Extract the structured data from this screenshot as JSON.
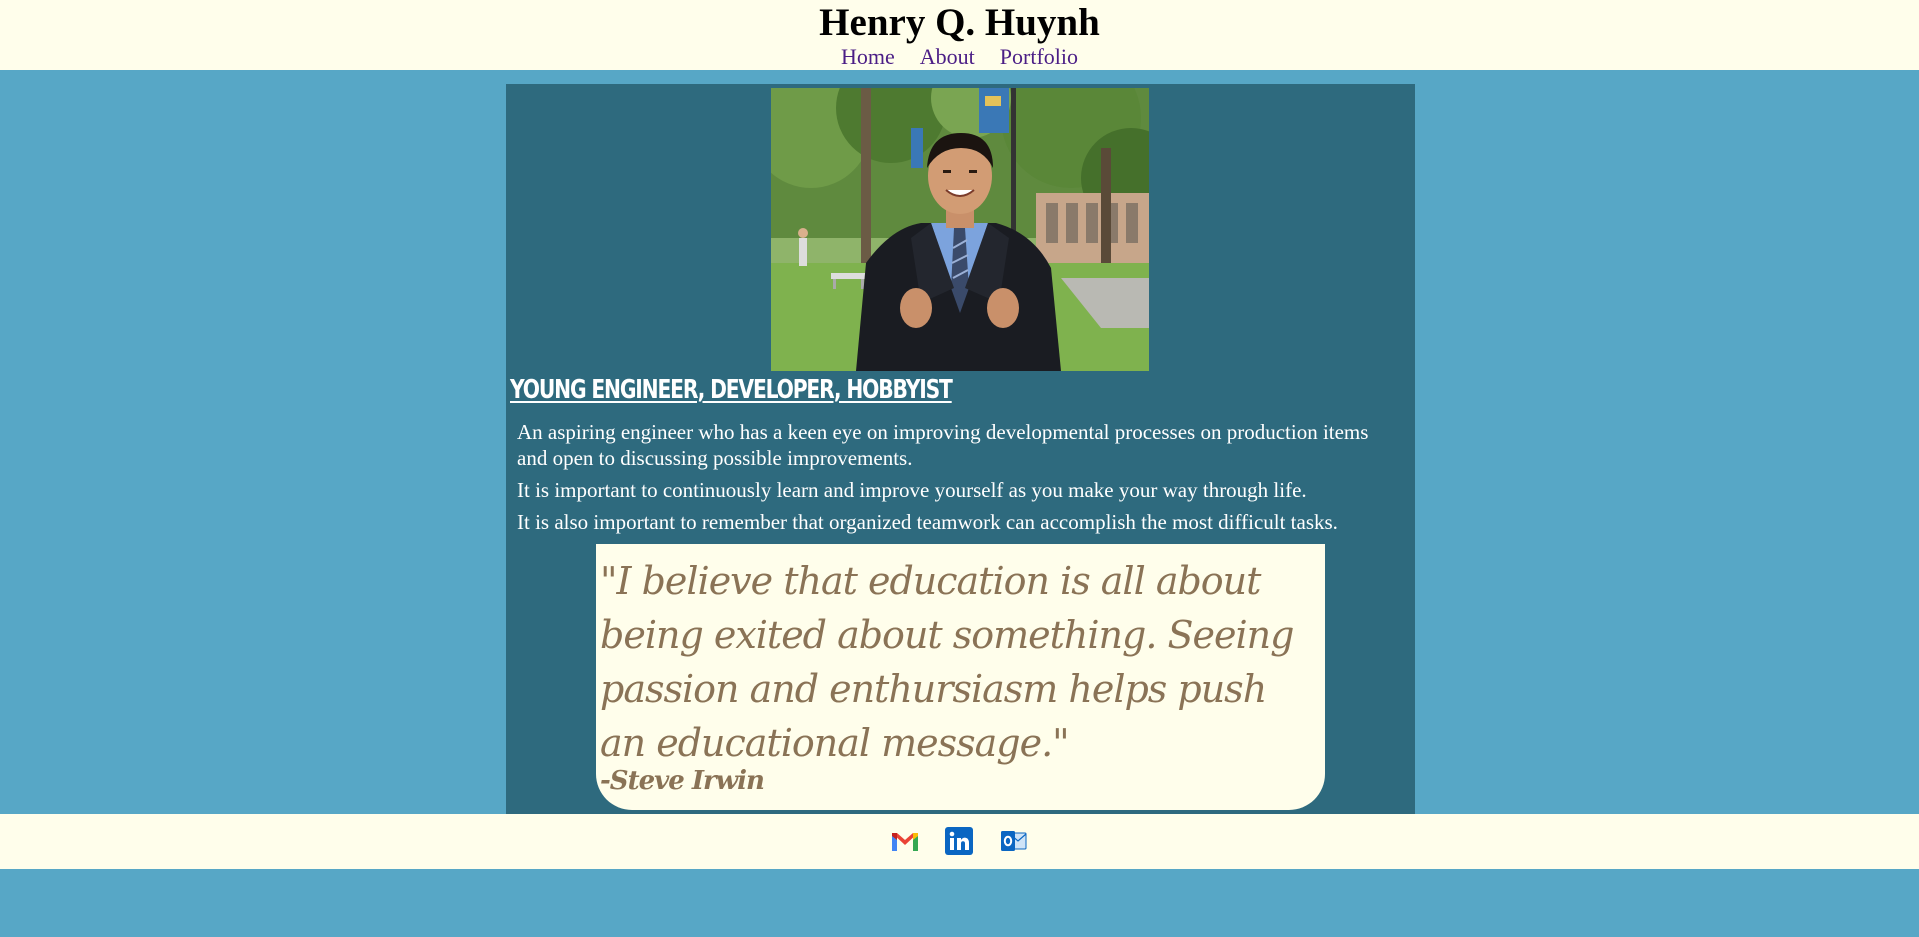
{
  "header": {
    "title": "Henry Q. Huynh",
    "nav": [
      "Home",
      "About",
      "Portfolio"
    ]
  },
  "profile": {
    "photo_alt": "Henry Q. Huynh"
  },
  "tagline": "YOUNG ENGINEER, DEVELOPER, HOBBYIST",
  "bio": [
    "An aspiring engineer who has a keen eye on improving developmental processes on production items and open to discussing possible improvements.",
    "It is important to continuously learn and improve yourself as you make your way through life.",
    "It is also important to remember that organized teamwork can accomplish the most difficult tasks."
  ],
  "quote": {
    "text": "\"I believe that education is all about being exited about something. Seeing passion and enthursiasm helps push an educational message.\"",
    "author": "-Steve Irwin"
  },
  "footer": {
    "icons": [
      "gmail-icon",
      "linkedin-icon",
      "outlook-icon"
    ]
  },
  "colors": {
    "page_background": "#57a7c6",
    "header_background": "#fffeeb",
    "panel_background": "#2e6a7e",
    "nav_link": "#4b1e86",
    "quote_text": "#8a7356"
  }
}
